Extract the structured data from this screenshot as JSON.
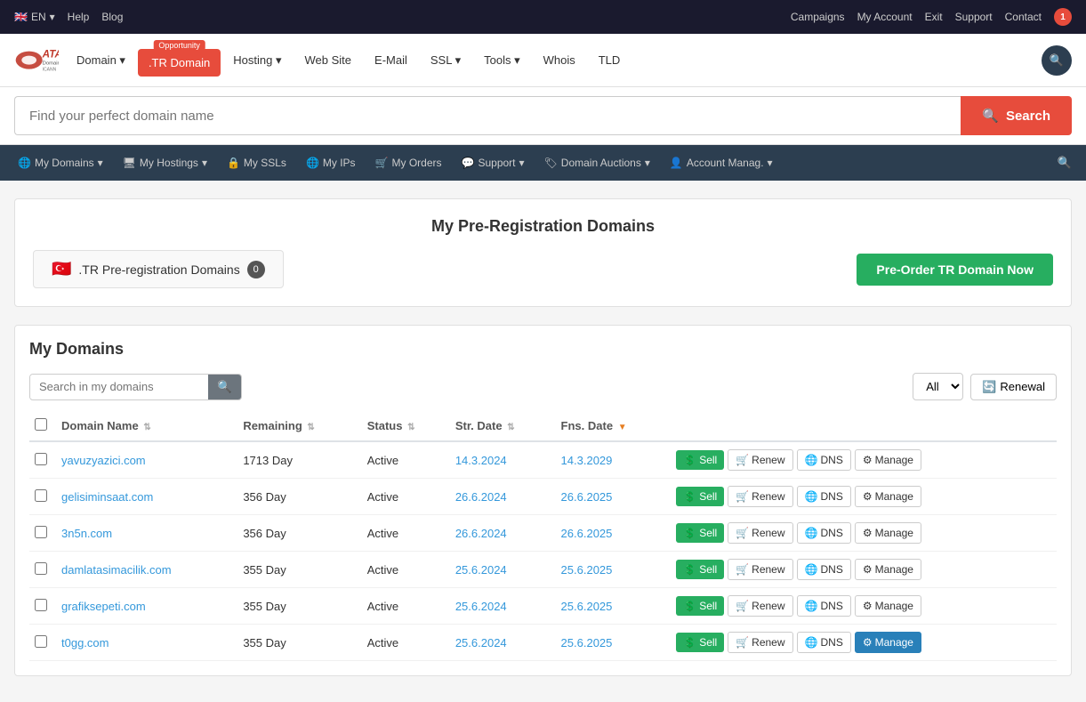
{
  "topbar": {
    "lang": "EN",
    "links": [
      "Help",
      "Blog"
    ],
    "right_links": [
      "Campaigns",
      "My Account",
      "Exit",
      "Support",
      "Contact"
    ],
    "cart_count": "1"
  },
  "mainnav": {
    "logo_text": "ATAK",
    "logo_sub1": "Domain & Hosting",
    "logo_sub2": "ICANN",
    "items": [
      {
        "label": "Domain",
        "has_dropdown": true
      },
      {
        "label": ".TR Domain",
        "badge": "Opportunity",
        "special": true
      },
      {
        "label": "Hosting",
        "has_dropdown": true
      },
      {
        "label": "Web Site",
        "has_dropdown": false
      },
      {
        "label": "E-Mail",
        "has_dropdown": false
      },
      {
        "label": "SSL",
        "has_dropdown": true
      },
      {
        "label": "Tools",
        "has_dropdown": true
      },
      {
        "label": "Whois",
        "has_dropdown": false
      },
      {
        "label": "TLD",
        "has_dropdown": false
      }
    ]
  },
  "searchbar": {
    "placeholder": "Find your perfect domain name",
    "button_label": "Search"
  },
  "secnav": {
    "items": [
      {
        "icon": "🌐",
        "label": "My Domains",
        "has_dropdown": true
      },
      {
        "icon": "🖥",
        "label": "My Hostings",
        "has_dropdown": true
      },
      {
        "icon": "🔒",
        "label": "My SSLs",
        "has_dropdown": false
      },
      {
        "icon": "🌐",
        "label": "My IPs",
        "has_dropdown": false
      },
      {
        "icon": "🛒",
        "label": "My Orders",
        "has_dropdown": false
      },
      {
        "icon": "💬",
        "label": "Support",
        "has_dropdown": true
      },
      {
        "icon": "🏷",
        "label": "Domain Auctions",
        "has_dropdown": true
      },
      {
        "icon": "👤",
        "label": "Account Manag.",
        "has_dropdown": true
      }
    ]
  },
  "prereg": {
    "title": "My Pre-Registration Domains",
    "tr_label": ".TR Pre-registration Domains",
    "count": "0",
    "preorder_btn": "Pre-Order TR Domain Now"
  },
  "mydomains": {
    "title": "My Domains",
    "search_placeholder": "Search in my domains",
    "filter_options": [
      "All"
    ],
    "filter_selected": "All",
    "renewal_btn": "Renewal",
    "columns": [
      {
        "label": "Domain Name",
        "sortable": true
      },
      {
        "label": "Remaining",
        "sortable": true
      },
      {
        "label": "Status",
        "sortable": true
      },
      {
        "label": "Str. Date",
        "sortable": true
      },
      {
        "label": "Fns. Date",
        "sortable": true,
        "sort_active": true
      }
    ],
    "rows": [
      {
        "domain": "yavuzyazici.com",
        "remaining": "1713 Day",
        "status": "Active",
        "str_date": "14.3.2024",
        "fns_date": "14.3.2029",
        "last_manage": false
      },
      {
        "domain": "gelisiminsaat.com",
        "remaining": "356 Day",
        "status": "Active",
        "str_date": "26.6.2024",
        "fns_date": "26.6.2025",
        "last_manage": false
      },
      {
        "domain": "3n5n.com",
        "remaining": "356 Day",
        "status": "Active",
        "str_date": "26.6.2024",
        "fns_date": "26.6.2025",
        "last_manage": false
      },
      {
        "domain": "damlatasimacilik.com",
        "remaining": "355 Day",
        "status": "Active",
        "str_date": "25.6.2024",
        "fns_date": "25.6.2025",
        "last_manage": false
      },
      {
        "domain": "grafiksepeti.com",
        "remaining": "355 Day",
        "status": "Active",
        "str_date": "25.6.2024",
        "fns_date": "25.6.2025",
        "last_manage": false
      },
      {
        "domain": "t0gg.com",
        "remaining": "355 Day",
        "status": "Active",
        "str_date": "25.6.2024",
        "fns_date": "25.6.2025",
        "last_manage": true
      }
    ],
    "btn_sell": "Sell",
    "btn_renew": "Renew",
    "btn_dns": "DNS",
    "btn_manage": "Manage"
  },
  "colors": {
    "topbar_bg": "#1a1a2e",
    "mainnav_bg": "#ffffff",
    "secnav_bg": "#2c3e50",
    "search_btn": "#e74c3c",
    "sell_btn": "#27ae60",
    "preorder_btn": "#27ae60",
    "manage_last": "#2980b9"
  }
}
